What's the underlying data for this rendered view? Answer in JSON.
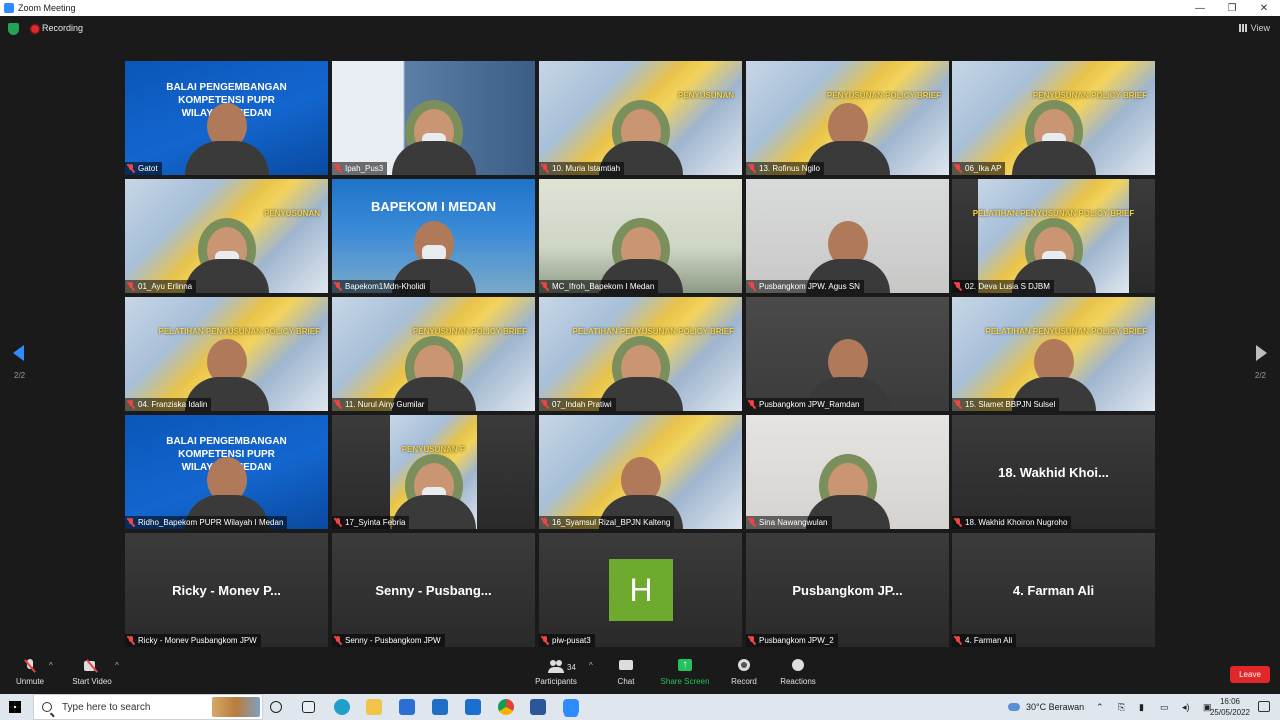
{
  "window": {
    "title": "Zoom Meeting",
    "minimize": "—",
    "restore": "❐",
    "close": "✕"
  },
  "meeting_bar": {
    "recording_label": "Recording",
    "view_label": "View"
  },
  "pagination": {
    "left": "2/2",
    "right": "2/2"
  },
  "tiles": [
    {
      "name": "Gatot",
      "scene": "balai",
      "banner": "BALAI PENGEMBANGAN KOMPETENSI PUPR WILAYAH I MEDAN"
    },
    {
      "name": "Ipah_Pus3",
      "scene": "pusat",
      "banner": ""
    },
    {
      "name": "10. Muria Istamtiah",
      "scene": "poster",
      "banner": "PENYUSUNAN"
    },
    {
      "name": "13. Rofinus Ngilo",
      "scene": "poster",
      "banner": "PENYUSUNAN POLICY BRIEF"
    },
    {
      "name": "06_Ika AP",
      "scene": "poster",
      "banner": "PENYUSUNAN POLICY BRIEF"
    },
    {
      "name": "01_Ayu Erlinna",
      "scene": "poster",
      "banner": "PENYUSUNAN"
    },
    {
      "name": "Bapekom1Mdn-Kholidi",
      "scene": "bapekom",
      "banner": "BAPEKOM I MEDAN"
    },
    {
      "name": "MC_Ifroh_Bapekom I Medan",
      "scene": "room",
      "banner": ""
    },
    {
      "name": "Pusbangkom JPW. Agus SN",
      "scene": "office",
      "banner": ""
    },
    {
      "name": "02. Deva Lusia S DJBM",
      "scene": "poster-narrow",
      "banner": "PELATIHAN PENYUSUNAN POLICY BRIEF"
    },
    {
      "name": "04. Franziska Idalin",
      "scene": "poster",
      "banner": "PELATIHAN PENYUSUNAN POLICY BRIEF"
    },
    {
      "name": "11. Nurul Ainy Gumilar",
      "scene": "poster",
      "banner": "PENYUSUNAN POLICY BRIEF"
    },
    {
      "name": "07_Indah Pratiwi",
      "scene": "poster",
      "banner": "PELATIHAN PENYUSUNAN POLICY BRIEF"
    },
    {
      "name": "Pusbangkom JPW_Ramdan",
      "scene": "blur",
      "banner": ""
    },
    {
      "name": "15. Slamet BBPJN Sulsel",
      "scene": "poster",
      "banner": "PELATIHAN PENYUSUNAN POLICY BRIEF"
    },
    {
      "name": "Ridho_Bapekom PUPR Wilayah I Medan",
      "scene": "balai",
      "banner": "BALAI PENGEMBANGAN KOMPETENSI PUPR WILAYAH I MEDAN"
    },
    {
      "name": "17_Syinta Febria",
      "scene": "poster-narrow2",
      "banner": "PENYUSUNAN P"
    },
    {
      "name": "16_Syamsul Rizal_BPJN Kalteng",
      "scene": "poster",
      "banner": ""
    },
    {
      "name": "Sina Nawangwulan",
      "scene": "light",
      "banner": ""
    },
    {
      "name": "18. Wakhid Khoiron Nugroho",
      "scene": "text",
      "banner": "18. Wakhid Khoi..."
    },
    {
      "name": "Ricky - Monev Pusbangkom JPW",
      "scene": "text",
      "banner": "Ricky - Monev P..."
    },
    {
      "name": "Senny - Pusbangkom JPW",
      "scene": "text",
      "banner": "Senny - Pusbang..."
    },
    {
      "name": "piw-pusat3",
      "scene": "avatar",
      "banner": "H"
    },
    {
      "name": "Pusbangkom JPW_2",
      "scene": "text",
      "banner": "Pusbangkom JP..."
    },
    {
      "name": "4. Farman Ali",
      "scene": "text",
      "banner": "4. Farman Ali"
    }
  ],
  "toolbar": {
    "unmute": "Unmute",
    "start_video": "Start Video",
    "participants": "Participants",
    "participants_count": "34",
    "chat": "Chat",
    "share_screen": "Share Screen",
    "record": "Record",
    "reactions": "Reactions",
    "leave": "Leave",
    "caret": "^"
  },
  "taskbar": {
    "search_placeholder": "Type here to search",
    "weather": "30°C  Berawan",
    "time": "16:06",
    "date": "25/05/2022"
  },
  "colors": {
    "accent": "#2d8cff",
    "leave": "#e02828",
    "share": "#23c25a",
    "active_speaker": "#c9d46a",
    "avatar_bg": "#6eaa2e"
  }
}
